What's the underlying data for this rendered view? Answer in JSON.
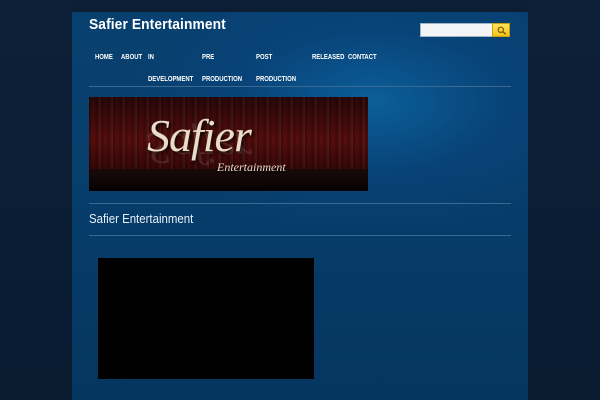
{
  "site": {
    "title": "Safier Entertainment"
  },
  "search": {
    "placeholder": "",
    "value": "",
    "icon": "search-icon"
  },
  "nav": {
    "items": [
      {
        "label": "HOME"
      },
      {
        "label": "ABOUT"
      },
      {
        "label": "IN DEVELOPMENT"
      },
      {
        "label": "PRE PRODUCTION"
      },
      {
        "label": "POST PRODUCTION"
      },
      {
        "label": "RELEASED"
      },
      {
        "label": "CONTACT"
      }
    ]
  },
  "banner": {
    "word": "Safier",
    "subtitle": "Entertainment"
  },
  "post": {
    "title": "Safier Entertainment"
  },
  "colors": {
    "page_background": "#0b1e33",
    "content_background": "#073e6c",
    "search_button": "#f2c417",
    "rule": "#3a6a92"
  }
}
